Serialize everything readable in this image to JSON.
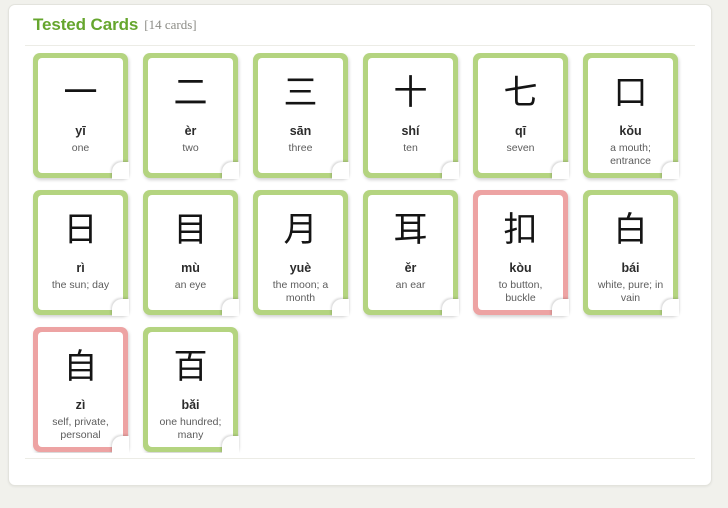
{
  "panel": {
    "title": "Tested Cards",
    "count_label": "[14 cards]"
  },
  "colors": {
    "title_green": "#66a62e",
    "card_border_green": "#b4d480",
    "card_border_red": "#eda3a3",
    "page_background": "#f1f1ec",
    "panel_background": "#ffffff",
    "count_text": "#8c8c86",
    "definition_text": "#5c5c5c"
  },
  "rows": [
    {
      "cards": [
        {
          "glyph": "一",
          "pinyin": "yī",
          "definition": "one",
          "status": "green"
        },
        {
          "glyph": "二",
          "pinyin": "èr",
          "definition": "two",
          "status": "green"
        },
        {
          "glyph": "三",
          "pinyin": "sān",
          "definition": "three",
          "status": "green"
        },
        {
          "glyph": "十",
          "pinyin": "shí",
          "definition": "ten",
          "status": "green"
        },
        {
          "glyph": "七",
          "pinyin": "qī",
          "definition": "seven",
          "status": "green"
        },
        {
          "glyph": "口",
          "pinyin": "kǒu",
          "definition": "a mouth; entrance",
          "status": "green"
        }
      ]
    },
    {
      "cards": [
        {
          "glyph": "日",
          "pinyin": "rì",
          "definition": "the sun; day",
          "status": "green"
        },
        {
          "glyph": "目",
          "pinyin": "mù",
          "definition": "an eye",
          "status": "green"
        },
        {
          "glyph": "月",
          "pinyin": "yuè",
          "definition": "the moon; a month",
          "status": "green"
        },
        {
          "glyph": "耳",
          "pinyin": "ěr",
          "definition": "an ear",
          "status": "green"
        },
        {
          "glyph": "扣",
          "pinyin": "kòu",
          "definition": "to button, buckle",
          "status": "red"
        },
        {
          "glyph": "白",
          "pinyin": "bái",
          "definition": "white, pure; in vain",
          "status": "green"
        }
      ]
    },
    {
      "cards": [
        {
          "glyph": "自",
          "pinyin": "zì",
          "definition": "self, private, personal",
          "status": "red"
        },
        {
          "glyph": "百",
          "pinyin": "bǎi",
          "definition": "one hundred; many",
          "status": "green"
        }
      ]
    }
  ]
}
